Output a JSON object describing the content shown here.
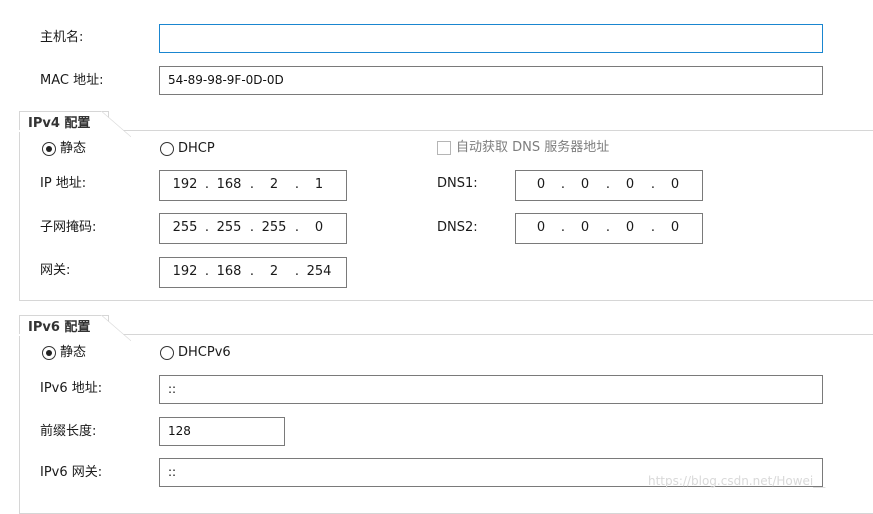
{
  "hostname": {
    "label": "主机名:",
    "value": ""
  },
  "mac": {
    "label": "MAC 地址:",
    "value": "54-89-98-9F-0D-0D"
  },
  "ipv4": {
    "title": "IPv4 配置",
    "static_label": "静态",
    "dhcp_label": "DHCP",
    "auto_dns_label": "自动获取 DNS 服务器地址",
    "ip_label": "IP 地址:",
    "ip": [
      "192",
      "168",
      "2",
      "1"
    ],
    "mask_label": "子网掩码:",
    "mask": [
      "255",
      "255",
      "255",
      "0"
    ],
    "gateway_label": "网关:",
    "gateway": [
      "192",
      "168",
      "2",
      "254"
    ],
    "dns1_label": "DNS1:",
    "dns1": [
      "0",
      "0",
      "0",
      "0"
    ],
    "dns2_label": "DNS2:",
    "dns2": [
      "0",
      "0",
      "0",
      "0"
    ]
  },
  "ipv6": {
    "title": "IPv6 配置",
    "static_label": "静态",
    "dhcp_label": "DHCPv6",
    "address_label": "IPv6 地址:",
    "address": "::",
    "prefix_label": "前缀长度:",
    "prefix": "128",
    "gateway_label": "IPv6 网关:",
    "gateway": "::"
  },
  "watermark": "https://blog.csdn.net/Howei__"
}
